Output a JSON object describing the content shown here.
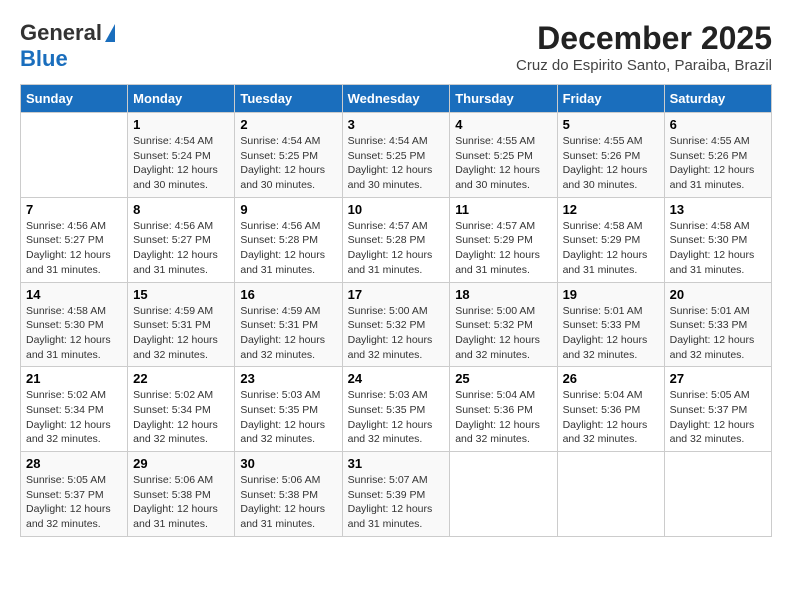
{
  "header": {
    "logo_line1": "General",
    "logo_line2": "Blue",
    "title": "December 2025",
    "subtitle": "Cruz do Espirito Santo, Paraiba, Brazil"
  },
  "weekdays": [
    "Sunday",
    "Monday",
    "Tuesday",
    "Wednesday",
    "Thursday",
    "Friday",
    "Saturday"
  ],
  "weeks": [
    [
      {
        "day": "",
        "sunrise": "",
        "sunset": "",
        "daylight": ""
      },
      {
        "day": "1",
        "sunrise": "Sunrise: 4:54 AM",
        "sunset": "Sunset: 5:24 PM",
        "daylight": "Daylight: 12 hours and 30 minutes."
      },
      {
        "day": "2",
        "sunrise": "Sunrise: 4:54 AM",
        "sunset": "Sunset: 5:25 PM",
        "daylight": "Daylight: 12 hours and 30 minutes."
      },
      {
        "day": "3",
        "sunrise": "Sunrise: 4:54 AM",
        "sunset": "Sunset: 5:25 PM",
        "daylight": "Daylight: 12 hours and 30 minutes."
      },
      {
        "day": "4",
        "sunrise": "Sunrise: 4:55 AM",
        "sunset": "Sunset: 5:25 PM",
        "daylight": "Daylight: 12 hours and 30 minutes."
      },
      {
        "day": "5",
        "sunrise": "Sunrise: 4:55 AM",
        "sunset": "Sunset: 5:26 PM",
        "daylight": "Daylight: 12 hours and 30 minutes."
      },
      {
        "day": "6",
        "sunrise": "Sunrise: 4:55 AM",
        "sunset": "Sunset: 5:26 PM",
        "daylight": "Daylight: 12 hours and 31 minutes."
      }
    ],
    [
      {
        "day": "7",
        "sunrise": "Sunrise: 4:56 AM",
        "sunset": "Sunset: 5:27 PM",
        "daylight": "Daylight: 12 hours and 31 minutes."
      },
      {
        "day": "8",
        "sunrise": "Sunrise: 4:56 AM",
        "sunset": "Sunset: 5:27 PM",
        "daylight": "Daylight: 12 hours and 31 minutes."
      },
      {
        "day": "9",
        "sunrise": "Sunrise: 4:56 AM",
        "sunset": "Sunset: 5:28 PM",
        "daylight": "Daylight: 12 hours and 31 minutes."
      },
      {
        "day": "10",
        "sunrise": "Sunrise: 4:57 AM",
        "sunset": "Sunset: 5:28 PM",
        "daylight": "Daylight: 12 hours and 31 minutes."
      },
      {
        "day": "11",
        "sunrise": "Sunrise: 4:57 AM",
        "sunset": "Sunset: 5:29 PM",
        "daylight": "Daylight: 12 hours and 31 minutes."
      },
      {
        "day": "12",
        "sunrise": "Sunrise: 4:58 AM",
        "sunset": "Sunset: 5:29 PM",
        "daylight": "Daylight: 12 hours and 31 minutes."
      },
      {
        "day": "13",
        "sunrise": "Sunrise: 4:58 AM",
        "sunset": "Sunset: 5:30 PM",
        "daylight": "Daylight: 12 hours and 31 minutes."
      }
    ],
    [
      {
        "day": "14",
        "sunrise": "Sunrise: 4:58 AM",
        "sunset": "Sunset: 5:30 PM",
        "daylight": "Daylight: 12 hours and 31 minutes."
      },
      {
        "day": "15",
        "sunrise": "Sunrise: 4:59 AM",
        "sunset": "Sunset: 5:31 PM",
        "daylight": "Daylight: 12 hours and 32 minutes."
      },
      {
        "day": "16",
        "sunrise": "Sunrise: 4:59 AM",
        "sunset": "Sunset: 5:31 PM",
        "daylight": "Daylight: 12 hours and 32 minutes."
      },
      {
        "day": "17",
        "sunrise": "Sunrise: 5:00 AM",
        "sunset": "Sunset: 5:32 PM",
        "daylight": "Daylight: 12 hours and 32 minutes."
      },
      {
        "day": "18",
        "sunrise": "Sunrise: 5:00 AM",
        "sunset": "Sunset: 5:32 PM",
        "daylight": "Daylight: 12 hours and 32 minutes."
      },
      {
        "day": "19",
        "sunrise": "Sunrise: 5:01 AM",
        "sunset": "Sunset: 5:33 PM",
        "daylight": "Daylight: 12 hours and 32 minutes."
      },
      {
        "day": "20",
        "sunrise": "Sunrise: 5:01 AM",
        "sunset": "Sunset: 5:33 PM",
        "daylight": "Daylight: 12 hours and 32 minutes."
      }
    ],
    [
      {
        "day": "21",
        "sunrise": "Sunrise: 5:02 AM",
        "sunset": "Sunset: 5:34 PM",
        "daylight": "Daylight: 12 hours and 32 minutes."
      },
      {
        "day": "22",
        "sunrise": "Sunrise: 5:02 AM",
        "sunset": "Sunset: 5:34 PM",
        "daylight": "Daylight: 12 hours and 32 minutes."
      },
      {
        "day": "23",
        "sunrise": "Sunrise: 5:03 AM",
        "sunset": "Sunset: 5:35 PM",
        "daylight": "Daylight: 12 hours and 32 minutes."
      },
      {
        "day": "24",
        "sunrise": "Sunrise: 5:03 AM",
        "sunset": "Sunset: 5:35 PM",
        "daylight": "Daylight: 12 hours and 32 minutes."
      },
      {
        "day": "25",
        "sunrise": "Sunrise: 5:04 AM",
        "sunset": "Sunset: 5:36 PM",
        "daylight": "Daylight: 12 hours and 32 minutes."
      },
      {
        "day": "26",
        "sunrise": "Sunrise: 5:04 AM",
        "sunset": "Sunset: 5:36 PM",
        "daylight": "Daylight: 12 hours and 32 minutes."
      },
      {
        "day": "27",
        "sunrise": "Sunrise: 5:05 AM",
        "sunset": "Sunset: 5:37 PM",
        "daylight": "Daylight: 12 hours and 32 minutes."
      }
    ],
    [
      {
        "day": "28",
        "sunrise": "Sunrise: 5:05 AM",
        "sunset": "Sunset: 5:37 PM",
        "daylight": "Daylight: 12 hours and 32 minutes."
      },
      {
        "day": "29",
        "sunrise": "Sunrise: 5:06 AM",
        "sunset": "Sunset: 5:38 PM",
        "daylight": "Daylight: 12 hours and 31 minutes."
      },
      {
        "day": "30",
        "sunrise": "Sunrise: 5:06 AM",
        "sunset": "Sunset: 5:38 PM",
        "daylight": "Daylight: 12 hours and 31 minutes."
      },
      {
        "day": "31",
        "sunrise": "Sunrise: 5:07 AM",
        "sunset": "Sunset: 5:39 PM",
        "daylight": "Daylight: 12 hours and 31 minutes."
      },
      {
        "day": "",
        "sunrise": "",
        "sunset": "",
        "daylight": ""
      },
      {
        "day": "",
        "sunrise": "",
        "sunset": "",
        "daylight": ""
      },
      {
        "day": "",
        "sunrise": "",
        "sunset": "",
        "daylight": ""
      }
    ]
  ]
}
